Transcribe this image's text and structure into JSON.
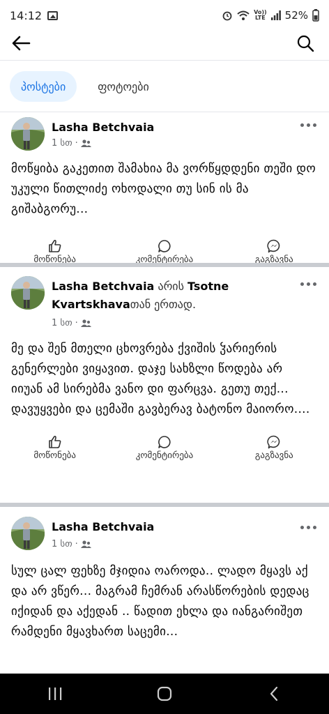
{
  "status_bar": {
    "time": "14:12",
    "battery": "52%",
    "volte_top": "Vo))",
    "volte_bottom": "LTE"
  },
  "header": {
    "back_icon": "arrow-left-icon",
    "search_icon": "search-icon"
  },
  "tabs": [
    {
      "label": "პოსტები",
      "active": true
    },
    {
      "label": "ფოტოები",
      "active": false
    }
  ],
  "actions": {
    "like": "მოწონება",
    "comment": "კომენტირება",
    "share": "გაგზავნა"
  },
  "posts": [
    {
      "author": "Lasha Betchvaia",
      "time": "1 სთ",
      "privacy_icon": "friends-icon",
      "text": "მოწყიბა გაკეთით შამახია მა ვორწყდდენი თეში დო უკული წითლიძე ოხოდალი თუ სინ ის მა გიშაბგორუ..."
    },
    {
      "author": "Lasha Betchvaia",
      "with_prefix": " არის ",
      "tagged": "Tsotne Kvartskhava",
      "with_suffix": "თან ერთად.",
      "time": "1 სთ",
      "privacy_icon": "friends-icon",
      "text": "მე და შენ მთელი ცხოვრება ქვიშის ჴარიერის გენერლები ვიყავით. დაჯე სახზლი წოდება არ იიუან ამ სირებმა ვანო დი ფარცვა. გეთუ თექ...\nდავუყვები და ცემაში გავბერავ ბატონო მაიორო...."
    },
    {
      "author": "Lasha Betchvaia",
      "time": "1 სთ",
      "privacy_icon": "friends-icon",
      "text": "სულ ცალ ფეხზე მჯიდია ოაროდა.. ლადო მყავს აქ და არ ვწერ... მაგრამ ჩემრან არასწორების დედაც იქიდან და აქედან .. წადით ეხლა და იანგარიშეთ რამდენი მყავხართ საცემი..."
    }
  ],
  "nav_bar": {
    "recent_icon": "recent-apps-icon",
    "home_icon": "home-icon",
    "back_icon": "back-chevron-icon"
  }
}
